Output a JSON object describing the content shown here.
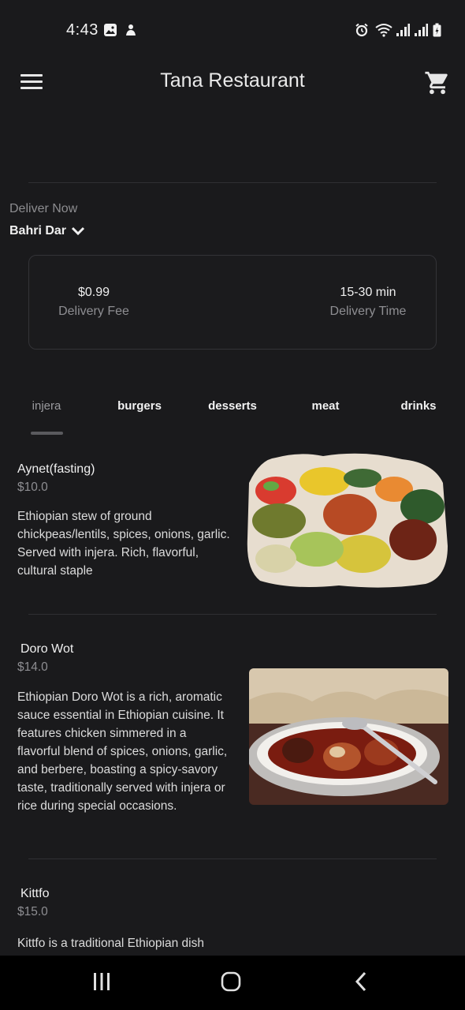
{
  "status_bar": {
    "time": "4:43"
  },
  "app_bar": {
    "title": "Tana Restaurant"
  },
  "delivery": {
    "mode_label": "Deliver Now",
    "city": "Bahri Dar",
    "fee_value": "$0.99",
    "fee_label": "Delivery Fee",
    "time_value": "15-30 min",
    "time_label": "Delivery Time"
  },
  "tabs": [
    {
      "label": "injera",
      "active": true
    },
    {
      "label": "burgers",
      "active": false
    },
    {
      "label": "desserts",
      "active": false
    },
    {
      "label": "meat",
      "active": false
    },
    {
      "label": "drinks",
      "active": false
    }
  ],
  "menu_items": [
    {
      "name": "Aynet(fasting)",
      "price": "$10.0",
      "description": "Ethiopian stew of ground chickpeas/lentils, spices, onions, garlic. Served with injera. Rich, flavorful, cultural staple"
    },
    {
      "name": "Doro Wot",
      "price": "$14.0",
      "description": "Ethiopian Doro Wot is a rich, aromatic sauce essential in Ethiopian cuisine. It features chicken simmered in a flavorful blend of spices, onions, garlic, and berbere, boasting a spicy-savory taste, traditionally served with injera or rice during special occasions."
    },
    {
      "name": "Kittfo",
      "price": "$15.0",
      "description": "Kittfo is a traditional Ethiopian dish"
    }
  ],
  "icons": {
    "menu": "hamburger-menu-icon",
    "cart": "shopping-cart-icon",
    "dropdown": "chevron-down-icon",
    "nav_recents": "recents-icon",
    "nav_home": "home-icon",
    "nav_back": "back-icon"
  },
  "colors": {
    "background": "#1a1a1c",
    "navbar": "#000000",
    "text": "#ececec",
    "muted": "#8e8e92"
  }
}
